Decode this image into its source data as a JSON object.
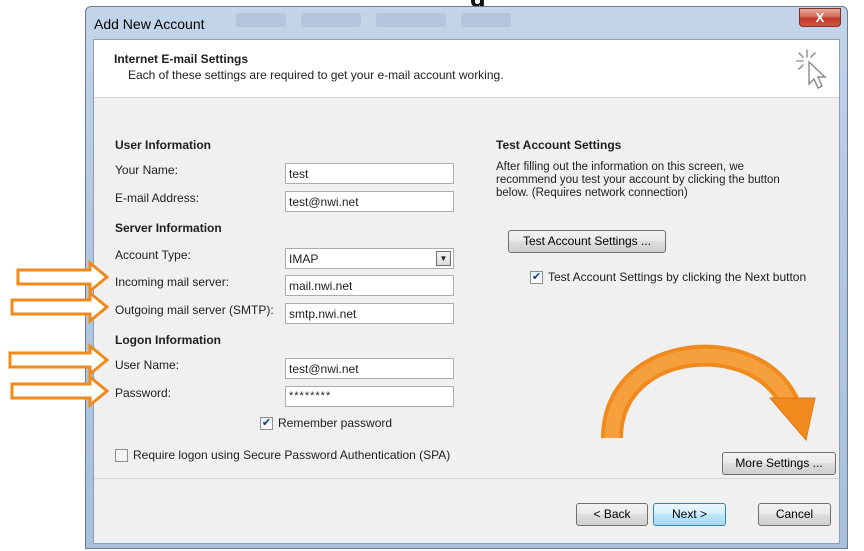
{
  "top_text": "g",
  "window": {
    "title": "Add New Account",
    "close_label": "X"
  },
  "header": {
    "title": "Internet E-mail Settings",
    "subtitle": "Each of these settings are required to get your e-mail account working."
  },
  "user_info": {
    "heading": "User Information",
    "name_label": "Your Name:",
    "name_value": "test",
    "email_label": "E-mail Address:",
    "email_value": "test@nwi.net"
  },
  "server_info": {
    "heading": "Server Information",
    "account_type_label": "Account Type:",
    "account_type_value": "IMAP",
    "incoming_label": "Incoming mail server:",
    "incoming_value": "mail.nwi.net",
    "outgoing_label": "Outgoing mail server (SMTP):",
    "outgoing_value": "smtp.nwi.net"
  },
  "logon_info": {
    "heading": "Logon Information",
    "username_label": "User Name:",
    "username_value": "test@nwi.net",
    "password_label": "Password:",
    "password_value": "********",
    "remember_label": "Remember password",
    "remember_checked": true,
    "spa_label": "Require logon using Secure Password Authentication (SPA)",
    "spa_checked": false
  },
  "test_settings": {
    "heading": "Test Account Settings",
    "description_1": "After filling out the information on this screen, we",
    "description_2": "recommend you test your account by clicking the button",
    "description_3": "below. (Requires network connection)",
    "button_label": "Test Account Settings ...",
    "next_check_label": "Test Account Settings by clicking the Next button",
    "next_check_checked": true
  },
  "more_settings_label": "More Settings ...",
  "footer": {
    "back_label": "< Back",
    "next_label": "Next >",
    "cancel_label": "Cancel"
  },
  "colors": {
    "annotation_orange": "#f08a1c",
    "arrow_outline": "#e98a2c"
  },
  "icons": {
    "wizard": "cursor-sparkle-icon",
    "dropdown": "chevron-down-icon",
    "check": "checkmark-icon"
  }
}
